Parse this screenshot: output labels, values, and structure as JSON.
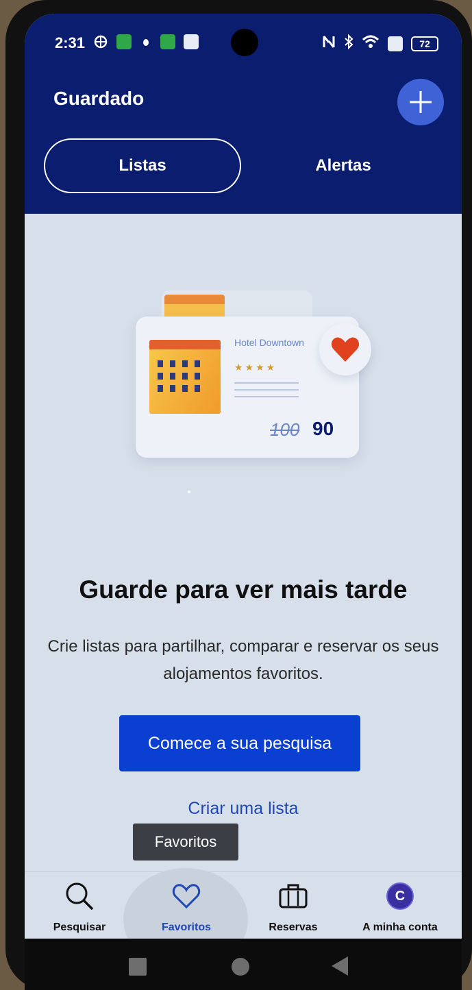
{
  "status_bar": {
    "time": "2:31",
    "battery": "72"
  },
  "header": {
    "title": "Guardado",
    "add_icon": "plus-icon"
  },
  "tabs": [
    {
      "label": "Listas",
      "selected": true
    },
    {
      "label": "Alertas",
      "selected": false
    }
  ],
  "illustration": {
    "hotel_name": "Hotel Downtown",
    "stars": "★★★★",
    "old_price": "100",
    "new_price": "90",
    "heart_color": "#e0411f"
  },
  "empty_state": {
    "headline": "Guarde para ver mais tarde",
    "description": "Crie listas para partilhar, comparar e reservar os seus alojamentos favoritos.",
    "cta_label": "Comece a sua pesquisa",
    "secondary_link": "Criar uma lista"
  },
  "tooltip": "Favoritos",
  "bottom_nav": [
    {
      "label": "Pesquisar",
      "icon": "search-icon",
      "active": false
    },
    {
      "label": "Favoritos",
      "icon": "heart-icon",
      "active": true
    },
    {
      "label": "Reservas",
      "icon": "briefcase-icon",
      "active": false
    },
    {
      "label": "A minha conta",
      "icon": "avatar",
      "avatar_letter": "C",
      "active": false
    }
  ],
  "colors": {
    "header_bg": "#0b1d6e",
    "primary": "#0a3fd1",
    "link": "#1f48b5",
    "active_nav": "#1f48b5"
  }
}
